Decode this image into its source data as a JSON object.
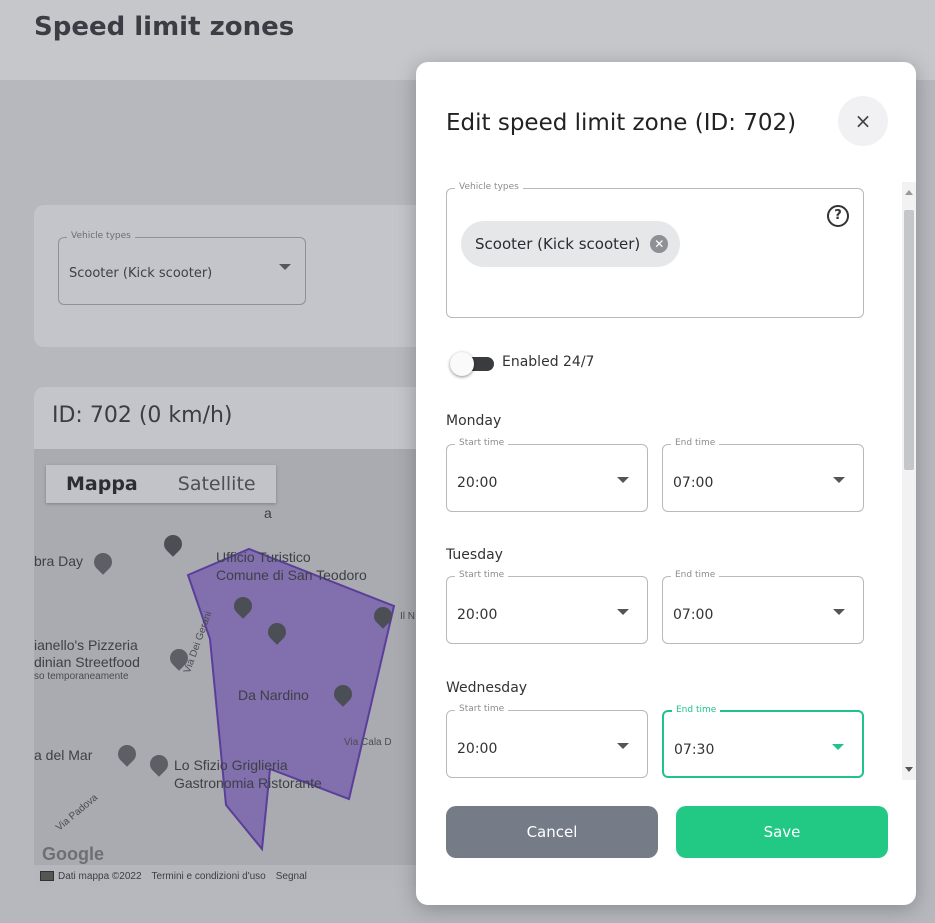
{
  "page": {
    "title": "Speed limit zones"
  },
  "filter": {
    "legend": "Vehicle types",
    "value": "Scooter (Kick scooter)"
  },
  "zone": {
    "title": "ID: 702 (0 km/h)"
  },
  "map": {
    "type_buttons": [
      "Mappa",
      "Satellite"
    ],
    "labels": {
      "ufficio_1": "Ufficio Turistico",
      "ufficio_2": "Comune di San Teodoro",
      "bra_day": "bra Day",
      "pizzeria_1": "ianello's Pizzeria",
      "pizzeria_2": "dinian Streetfood",
      "pizzeria_3": "so temporaneamente",
      "nardino": "Da Nardino",
      "del_mar": "a del Mar",
      "sfizio_1": "Lo Sfizio Griglieria",
      "sfizio_2": "Gastronomia Ristorante",
      "via_gerani": "Via Dei Gerani",
      "via_cala": "Via Cala D",
      "via_padova": "Via Padova",
      "il_n": "Il N",
      "letter_a": "a"
    },
    "footer": {
      "data": "Dati mappa ©2022",
      "terms": "Termini e condizioni d'uso",
      "report": "Segnal"
    },
    "logo": "Google"
  },
  "modal": {
    "title": "Edit speed limit zone (ID: 702)",
    "close_label": "×",
    "vehicle_types": {
      "legend": "Vehicle types",
      "chip": "Scooter (Kick scooter)",
      "help": "?"
    },
    "toggle_label": "Enabled 24/7",
    "toggle_on": false,
    "days": [
      {
        "name": "Monday",
        "start_legend": "Start time",
        "start": "20:00",
        "end_legend": "End time",
        "end": "07:00"
      },
      {
        "name": "Tuesday",
        "start_legend": "Start time",
        "start": "20:00",
        "end_legend": "End time",
        "end": "07:00"
      },
      {
        "name": "Wednesday",
        "start_legend": "Start time",
        "start": "20:00",
        "end_legend": "End time",
        "end": "07:30"
      }
    ],
    "cancel_label": "Cancel",
    "save_label": "Save"
  },
  "colors": {
    "accent": "#22c985",
    "focus": "#22c38b",
    "cancel": "#767c87",
    "zone_fill": "#7a64ae",
    "zone_stroke": "#5b3e9a"
  }
}
